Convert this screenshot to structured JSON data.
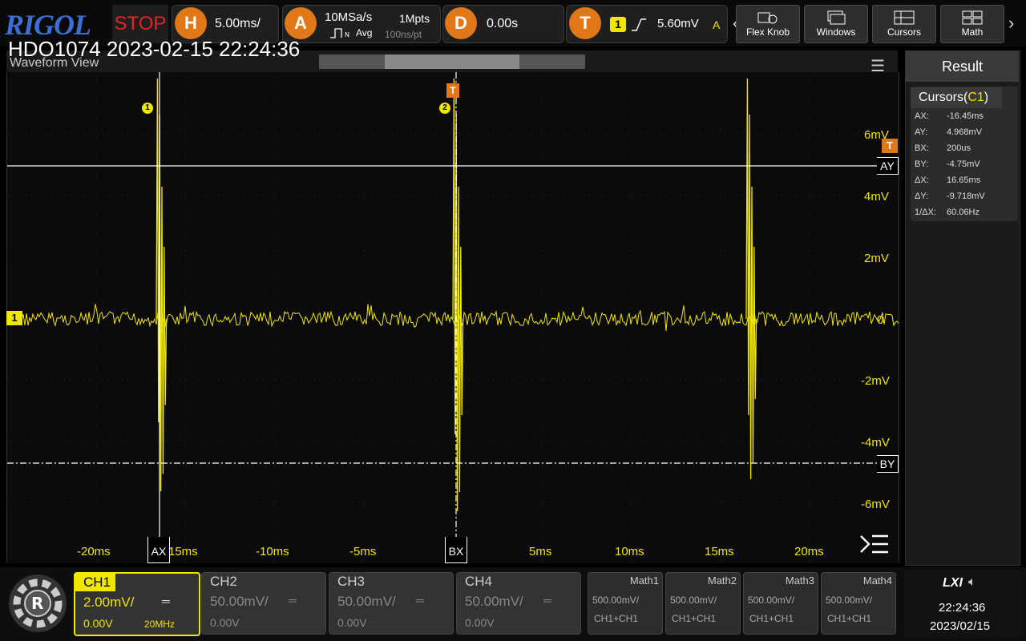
{
  "topbar": {
    "logo": "RIGOL",
    "run_state": "STOP",
    "horizontal": {
      "badge": "H",
      "value": "5.00ms/"
    },
    "acquire": {
      "badge": "A",
      "sample_rate": "10MSa/s",
      "mode": "Avg",
      "memory": "1Mpts",
      "resolution": "100ns/pt"
    },
    "delay": {
      "badge": "D",
      "value": "0.00s"
    },
    "trigger": {
      "badge": "T",
      "channel": "1",
      "level": "5.60mV",
      "mode": "A"
    },
    "buttons": [
      {
        "label": "Flex Knob",
        "icon": "flex-knob-icon"
      },
      {
        "label": "Windows",
        "icon": "windows-icon"
      },
      {
        "label": "Cursors",
        "icon": "cursors-icon"
      },
      {
        "label": "Math",
        "icon": "math-icon"
      }
    ]
  },
  "overlay_title": "HDO1074 2023-02-15 22:24:36",
  "waveform": {
    "title": "Waveform View",
    "y_labels": [
      "6mV",
      "4mV",
      "2mV",
      "0",
      "-2mV",
      "-4mV",
      "-6mV"
    ],
    "x_labels": [
      "-20ms",
      "-15ms",
      "-10ms",
      "-5ms",
      "0",
      "5ms",
      "10ms",
      "15ms",
      "20ms"
    ],
    "cursor_tags": {
      "ax": "AX",
      "bx": "BX",
      "ay": "AY",
      "by": "BY"
    },
    "trigger_tag": "T",
    "channel_marker": "1",
    "cursor_markers": [
      "1",
      "2"
    ],
    "color": "#f0e600"
  },
  "result_panel": {
    "title": "Result",
    "cursors_title": "Cursors(",
    "cursors_source": "C1",
    "cursors_close": ")",
    "rows": [
      {
        "k": "AX:",
        "v": "-16.45ms"
      },
      {
        "k": "AY:",
        "v": "4.968mV"
      },
      {
        "k": "BX:",
        "v": "200us"
      },
      {
        "k": "BY:",
        "v": "-4.75mV"
      },
      {
        "k": "ΔX:",
        "v": "16.65ms"
      },
      {
        "k": "ΔY:",
        "v": "-9.718mV"
      },
      {
        "k": "1/ΔX:",
        "v": "60.06Hz"
      }
    ]
  },
  "channels": [
    {
      "name": "CH1",
      "scale": "2.00mV/",
      "offset": "0.00V",
      "bw": "20MHz",
      "active": true
    },
    {
      "name": "CH2",
      "scale": "50.00mV/",
      "offset": "0.00V",
      "bw": "",
      "active": false
    },
    {
      "name": "CH3",
      "scale": "50.00mV/",
      "offset": "0.00V",
      "bw": "",
      "active": false
    },
    {
      "name": "CH4",
      "scale": "50.00mV/",
      "offset": "0.00V",
      "bw": "",
      "active": false
    }
  ],
  "maths": [
    {
      "name": "Math1",
      "scale": "500.00mV/",
      "src": "CH1+CH1"
    },
    {
      "name": "Math2",
      "scale": "500.00mV/",
      "src": "CH1+CH1"
    },
    {
      "name": "Math3",
      "scale": "500.00mV/",
      "src": "CH1+CH1"
    },
    {
      "name": "Math4",
      "scale": "500.00mV/",
      "src": "CH1+CH1"
    }
  ],
  "status": {
    "lxi": "LXI",
    "time": "22:24:36",
    "date": "2023/02/15"
  }
}
